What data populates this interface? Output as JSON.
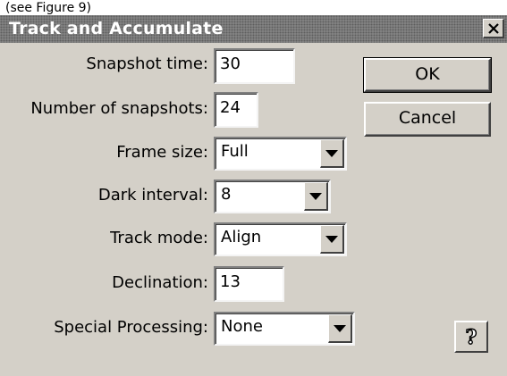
{
  "caption_hint": "(see Figure 9)",
  "dialog": {
    "title": "Track and Accumulate",
    "close_glyph": "✕"
  },
  "form": {
    "snapshot_time": {
      "label": "Snapshot time:",
      "value": "30"
    },
    "number_of_snapshots": {
      "label": "Number of snapshots:",
      "value": "24"
    },
    "frame_size": {
      "label": "Frame size:",
      "selected": "Full"
    },
    "dark_interval": {
      "label": "Dark interval:",
      "selected": "8"
    },
    "track_mode": {
      "label": "Track mode:",
      "selected": "Align"
    },
    "declination": {
      "label": "Declination:",
      "value": "13"
    },
    "special_processing": {
      "label": "Special Processing:",
      "selected": "None"
    }
  },
  "buttons": {
    "ok": "OK",
    "cancel": "Cancel",
    "help_glyph": "?"
  },
  "icons": {
    "close": "close-icon",
    "dropdown": "chevron-down-icon",
    "help": "help-icon"
  },
  "colors": {
    "face": "#d4d0c8",
    "titlebar": "#8a8a8a"
  }
}
